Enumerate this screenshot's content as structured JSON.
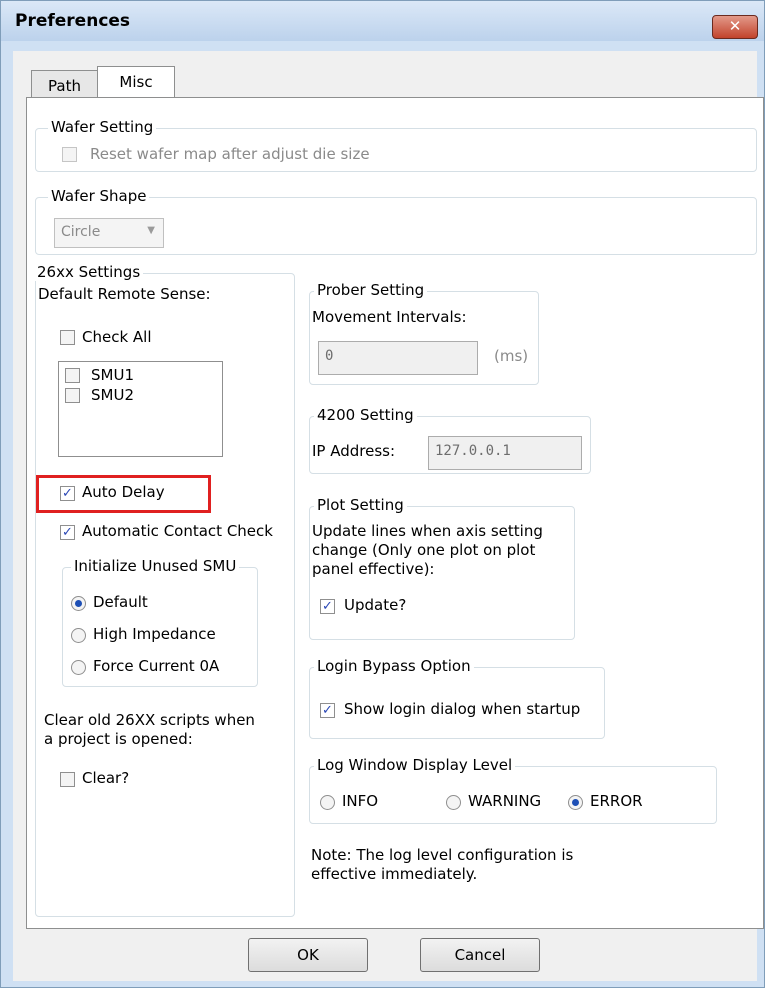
{
  "window": {
    "title": "Preferences",
    "close_label": "✕"
  },
  "tabs": [
    {
      "label": "Path"
    },
    {
      "label": "Misc"
    }
  ],
  "wafer_setting": {
    "legend": "Wafer Setting",
    "reset_label": "Reset wafer map after adjust die size"
  },
  "wafer_shape": {
    "legend": "Wafer Shape",
    "selected": "Circle"
  },
  "settings_26xx": {
    "legend": "26xx Settings",
    "remote_sense_label": "Default Remote Sense:",
    "check_all_label": "Check All",
    "smu_items": [
      {
        "label": "SMU1"
      },
      {
        "label": "SMU2"
      }
    ],
    "auto_delay_label": "Auto Delay",
    "auto_contact_label": "Automatic Contact Check",
    "unused_smu": {
      "legend": "Initialize Unused SMU",
      "options": [
        {
          "label": "Default"
        },
        {
          "label": "High Impedance"
        },
        {
          "label": "Force Current 0A"
        }
      ]
    },
    "clear_text_1": "Clear old 26XX scripts when",
    "clear_text_2": "a project is opened:",
    "clear_label": "Clear?"
  },
  "prober": {
    "legend": "Prober Setting",
    "label": "Movement Intervals:",
    "value": "0",
    "unit": "(ms)"
  },
  "s4200": {
    "legend": "4200 Setting",
    "ip_label": "IP Address:",
    "ip_value": "127.0.0.1"
  },
  "plot": {
    "legend": "Plot Setting",
    "text_1": "Update lines when axis setting",
    "text_2": "change (Only one plot on plot",
    "text_3": "panel effective):",
    "update_label": "Update?"
  },
  "login": {
    "legend": "Login Bypass Option",
    "show_label": "Show login dialog when startup"
  },
  "log": {
    "legend": "Log Window Display Level",
    "options": [
      {
        "label": "INFO"
      },
      {
        "label": "WARNING"
      },
      {
        "label": "ERROR"
      }
    ],
    "note_1": "Note: The log level configuration is",
    "note_2": "effective immediately."
  },
  "buttons": {
    "ok": "OK",
    "cancel": "Cancel"
  }
}
